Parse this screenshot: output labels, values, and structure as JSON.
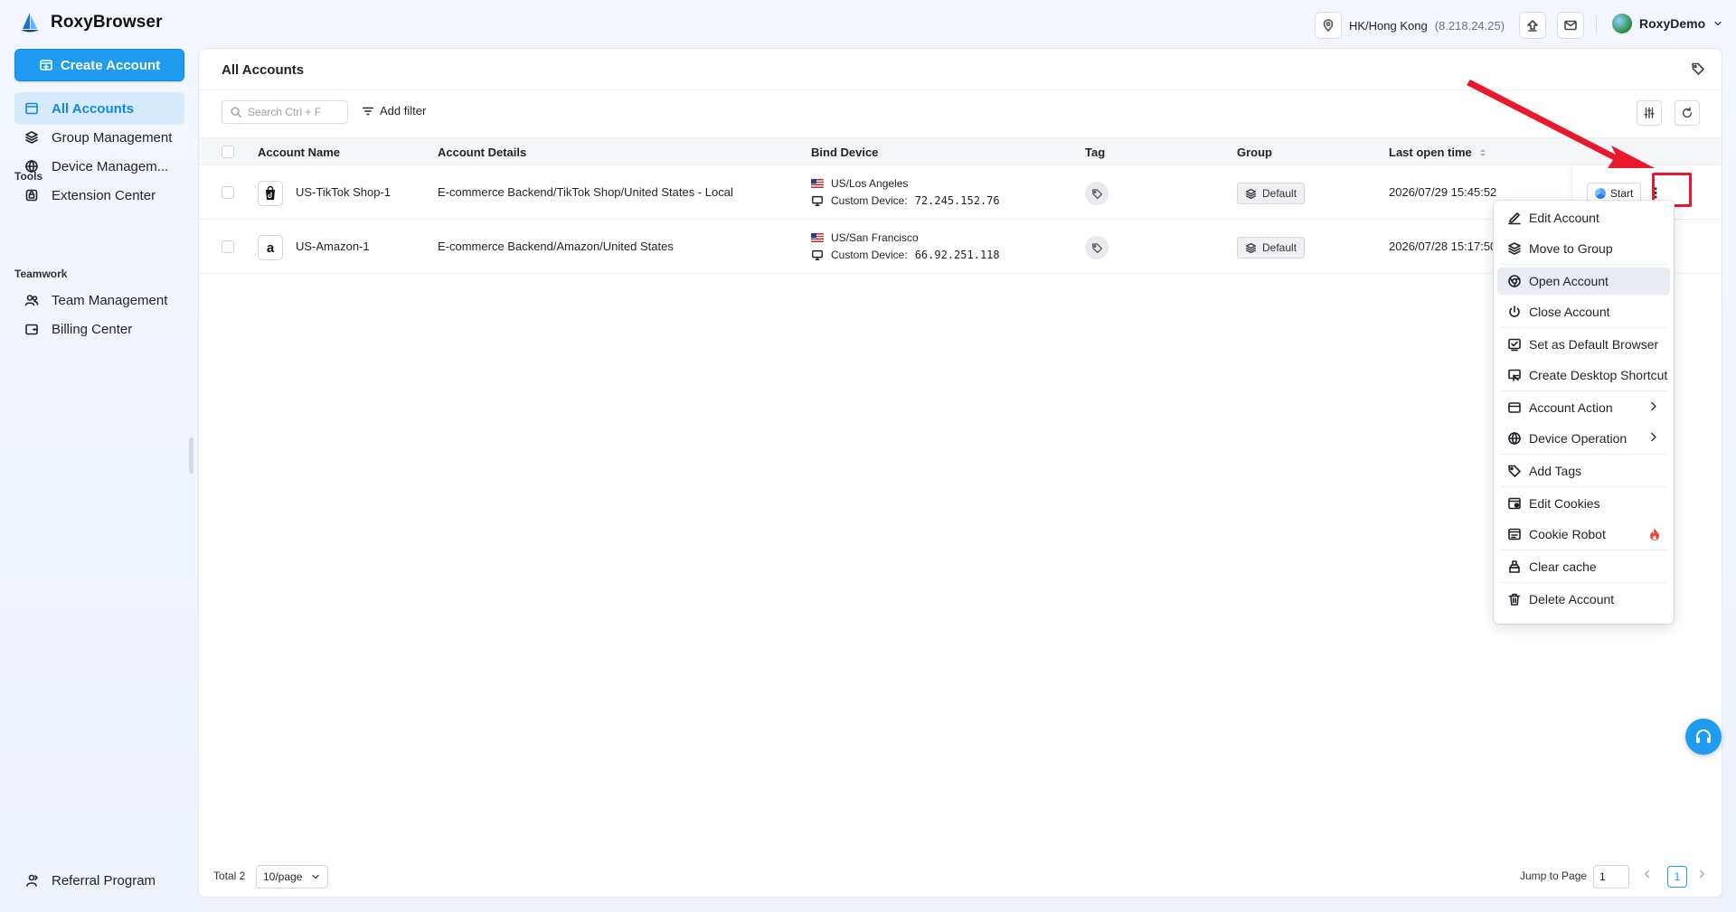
{
  "app": {
    "name": "RoxyBrowser"
  },
  "topbar": {
    "location": "HK/Hong Kong",
    "ip": "(8.218.24.25)",
    "user": "RoxyDemo"
  },
  "sidebar": {
    "create_label": "Create Account",
    "items": [
      {
        "label": "All Accounts",
        "icon": "browser-icon"
      },
      {
        "label": "Group Management",
        "icon": "layers-icon"
      },
      {
        "label": "Device Managem...",
        "icon": "globe-icon"
      }
    ],
    "sections": [
      {
        "title": "Tools",
        "items": [
          {
            "label": "Extension Center",
            "icon": "extension-icon"
          }
        ]
      },
      {
        "title": "Teamwork",
        "items": [
          {
            "label": "Team Management",
            "icon": "team-icon"
          },
          {
            "label": "Billing Center",
            "icon": "wallet-icon"
          }
        ]
      }
    ],
    "referral": "Referral Program"
  },
  "main": {
    "title": "All Accounts",
    "search_placeholder": "Search Ctrl + F",
    "add_filter": "Add filter",
    "columns": [
      "Account Name",
      "Account Details",
      "Bind Device",
      "Tag",
      "Group",
      "Last open time"
    ],
    "rows": [
      {
        "icon_letter": "♪",
        "name": "US-TikTok Shop-1",
        "details": "E-commerce Backend/TikTok Shop/United States - Local",
        "region": "US/Los Angeles",
        "device_label": "Custom Device:",
        "device_ip": "72.245.152.76",
        "group": "Default",
        "last_open": "2026/07/29 15:45:52"
      },
      {
        "icon_letter": "a",
        "name": "US-Amazon-1",
        "details": "E-commerce Backend/Amazon/United States",
        "region": "US/San Francisco",
        "device_label": "Custom Device:",
        "device_ip": "66.92.251.118",
        "group": "Default",
        "last_open": "2026/07/28 15:17:50"
      }
    ],
    "start_label": "Start",
    "more_label": "⋮"
  },
  "footer": {
    "total": "Total 2",
    "page_size": "10/page",
    "jump_label": "Jump to Page",
    "jump_value": "1",
    "current_page": "1"
  },
  "menu": {
    "items": [
      {
        "label": "Edit Account",
        "icon": "edit-icon"
      },
      {
        "label": "Move to Group",
        "icon": "layers-icon"
      },
      {
        "label": "Open Account",
        "icon": "chrome-icon"
      },
      {
        "label": "Close Account",
        "icon": "power-icon"
      },
      {
        "label": "Set as Default Browser",
        "icon": "check-square-icon"
      },
      {
        "label": "Create Desktop Shortcut",
        "icon": "shortcut-icon"
      },
      {
        "label": "Account Action",
        "icon": "window-icon"
      },
      {
        "label": "Device Operation",
        "icon": "globe-icon"
      },
      {
        "label": "Add Tags",
        "icon": "tag-icon"
      },
      {
        "label": "Edit Cookies",
        "icon": "cookie-icon"
      },
      {
        "label": "Cookie Robot",
        "icon": "robot-icon"
      },
      {
        "label": "Clear cache",
        "icon": "clean-icon"
      },
      {
        "label": "Delete Account",
        "icon": "trash-icon"
      }
    ]
  },
  "colors": {
    "accent": "#1f9bf0",
    "annotation": "#e8192c"
  }
}
